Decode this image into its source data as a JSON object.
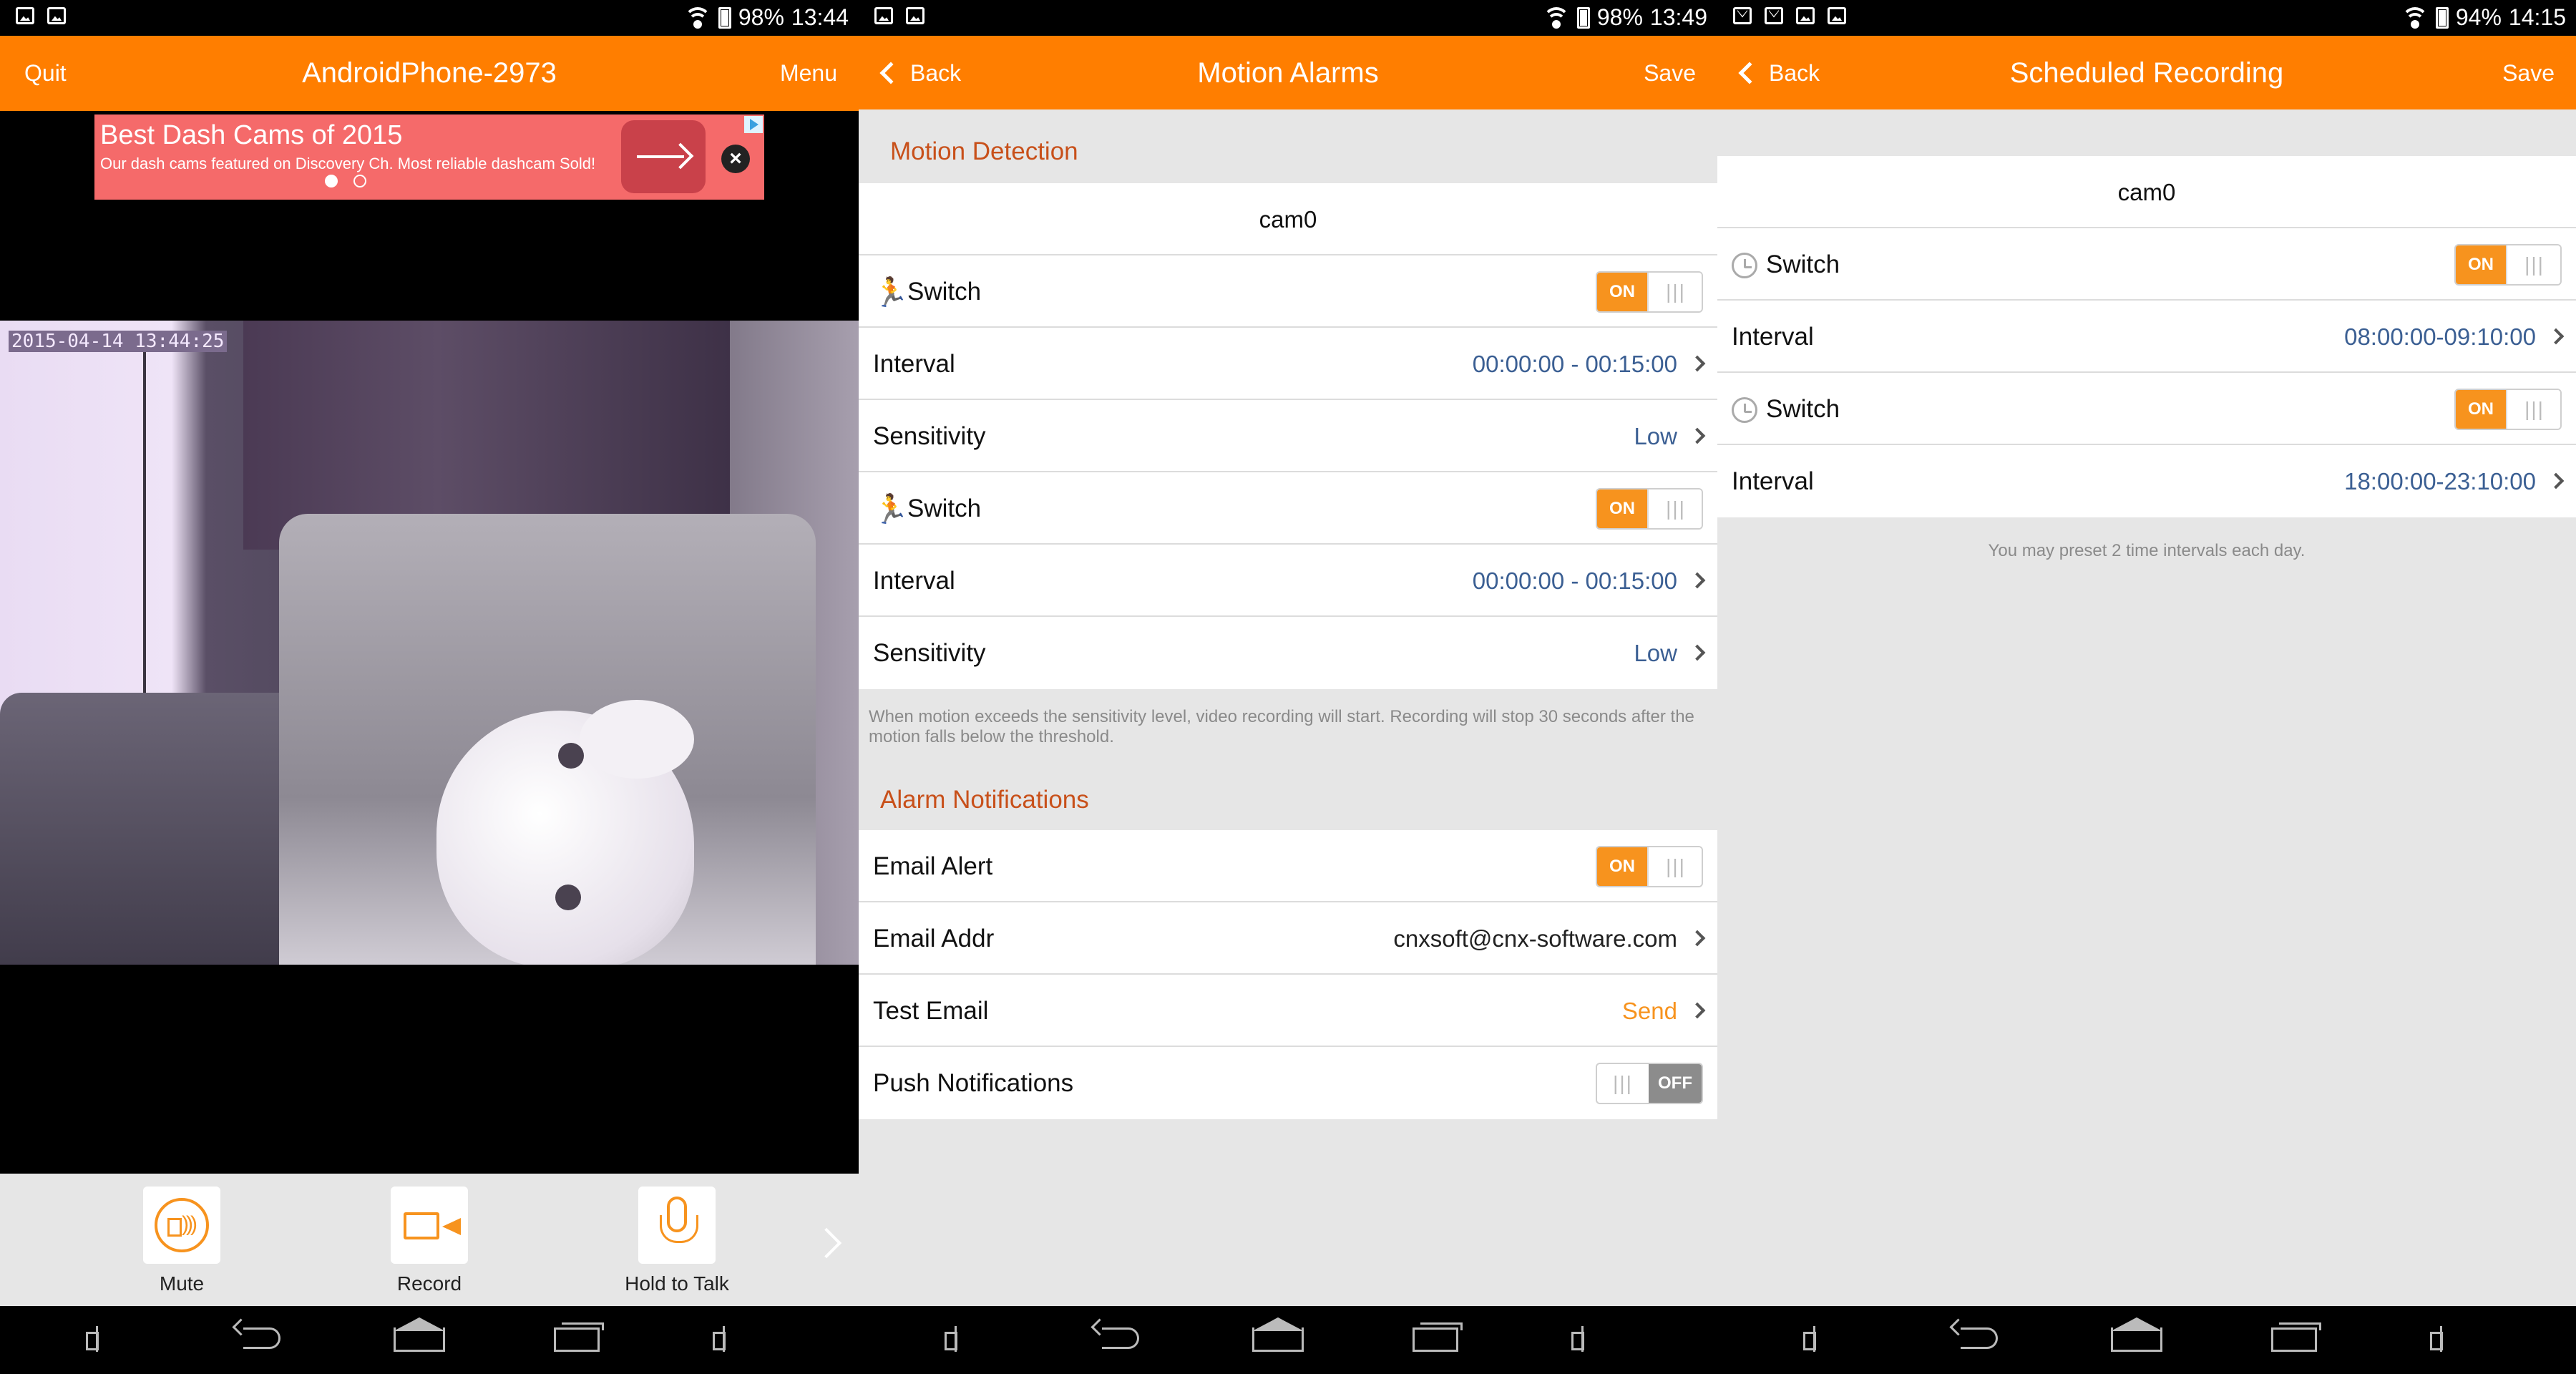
{
  "screens": {
    "live": {
      "status": {
        "battery": "98%",
        "time": "13:44"
      },
      "header": {
        "left": "Quit",
        "title": "AndroidPhone-2973",
        "right": "Menu"
      },
      "ad": {
        "title": "Best Dash Cams of 2015",
        "description": "Our dash cams featured on Discovery Ch. Most reliable dashcam Sold!"
      },
      "video": {
        "timestamp": "2015-04-14 13:44:25"
      },
      "controls": [
        {
          "label": "Mute"
        },
        {
          "label": "Record"
        },
        {
          "label": "Hold to Talk"
        }
      ]
    },
    "motion": {
      "status": {
        "battery": "98%",
        "time": "13:49"
      },
      "header": {
        "back": "Back",
        "title": "Motion Alarms",
        "right": "Save"
      },
      "section1": "Motion Detection",
      "camera": "cam0",
      "rows": [
        {
          "label": "Switch",
          "toggle": "ON"
        },
        {
          "label": "Interval",
          "value": "00:00:00 - 00:15:00"
        },
        {
          "label": "Sensitivity",
          "value": "Low"
        },
        {
          "label": "Switch",
          "toggle": "ON"
        },
        {
          "label": "Interval",
          "value": "00:00:00 - 00:15:00"
        },
        {
          "label": "Sensitivity",
          "value": "Low"
        }
      ],
      "note": "When motion exceeds the sensitivity level, video recording will start. Recording will stop 30 seconds after the motion falls below the threshold.",
      "section2": "Alarm Notifications",
      "notify": [
        {
          "label": "Email Alert",
          "toggle": "ON"
        },
        {
          "label": "Email Addr",
          "value": "cnxsoft@cnx-software.com"
        },
        {
          "label": "Test Email",
          "value": "Send"
        },
        {
          "label": "Push Notifications",
          "toggle": "OFF"
        }
      ]
    },
    "schedule": {
      "status": {
        "battery": "94%",
        "time": "14:15"
      },
      "header": {
        "back": "Back",
        "title": "Scheduled Recording",
        "right": "Save"
      },
      "camera": "cam0",
      "rows": [
        {
          "label": "Switch",
          "toggle": "ON"
        },
        {
          "label": "Interval",
          "value": "08:00:00-09:10:00"
        },
        {
          "label": "Switch",
          "toggle": "ON"
        },
        {
          "label": "Interval",
          "value": "18:00:00-23:10:00"
        }
      ],
      "note": "You may preset 2 time intervals each day."
    }
  },
  "colors": {
    "accent": "#ff7e00",
    "section": "#c8501a",
    "value": "#3b5f93"
  }
}
